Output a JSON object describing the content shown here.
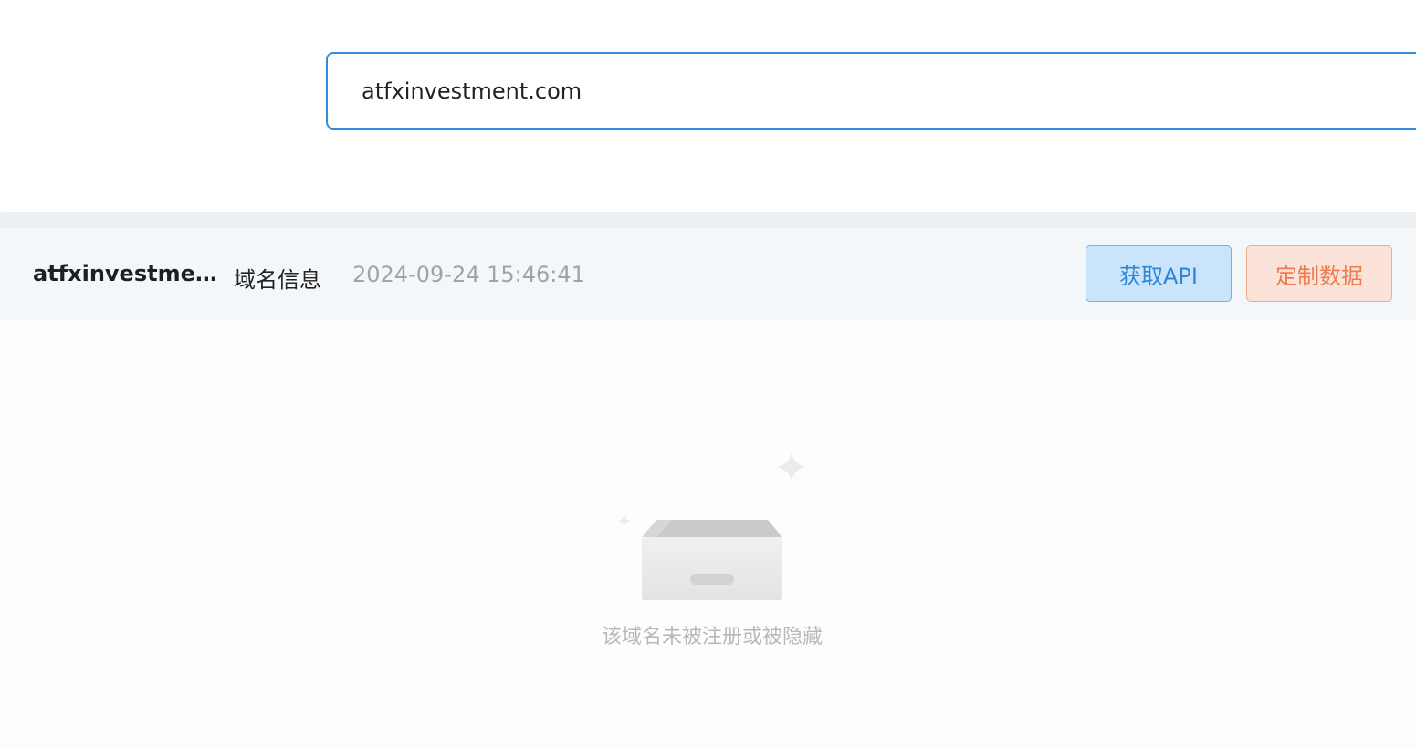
{
  "search": {
    "value": "atfxinvestment.com"
  },
  "info_bar": {
    "domain": "atfxinvestmen...",
    "label": "域名信息",
    "timestamp": "2024-09-24 15:46:41",
    "api_button": "获取API",
    "custom_button": "定制数据"
  },
  "empty_state": {
    "message": "该域名未被注册或被隐藏",
    "icon": "empty-box-icon"
  },
  "colors": {
    "accent": "#2f8fdc",
    "api_button_bg": "#c9e4fb",
    "custom_button_bg": "#fbe3da",
    "custom_button_text": "#ee7c50"
  }
}
